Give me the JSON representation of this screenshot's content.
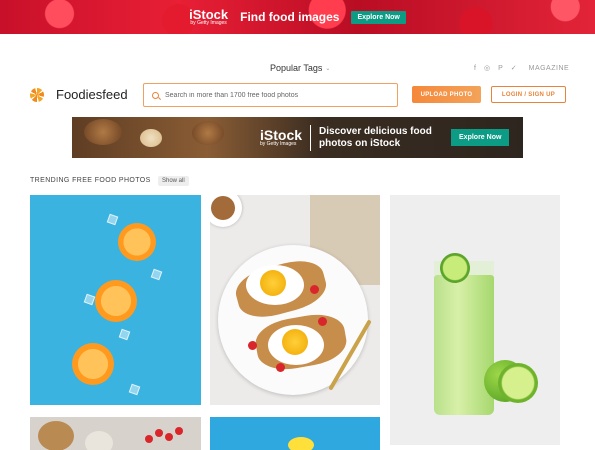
{
  "top_banner": {
    "logo": "iStock",
    "logo_sub": "by Getty Images",
    "text": "Find food images",
    "button": "Explore Now"
  },
  "header": {
    "popular_tags": "Popular Tags",
    "social": [
      "f",
      "◎",
      "P",
      "✓"
    ],
    "magazine": "MAGAZINE",
    "site_name": "Foodiesfeed",
    "search_placeholder": "Search in more than 1700 free food photos",
    "upload_button": "UPLOAD PHOTO",
    "login_button": "LOGIN / SIGN UP"
  },
  "ad_banner": {
    "logo": "iStock",
    "logo_sub": "by Getty Images",
    "text": "Discover delicious food photos on iStock",
    "button": "Explore Now"
  },
  "trending": {
    "label": "TRENDING FREE FOOD PHOTOS",
    "show_all": "Show all"
  },
  "photos": [
    {
      "subject": "orange slices on blue"
    },
    {
      "subject": "fried eggs on toast"
    },
    {
      "subject": "lime juice with limes"
    },
    {
      "subject": "bowls of ingredients"
    },
    {
      "subject": "lemon on blue"
    }
  ],
  "colors": {
    "accent": "#e8843a",
    "istock_button": "#0c9b84",
    "banner_red": "#d9182c"
  }
}
